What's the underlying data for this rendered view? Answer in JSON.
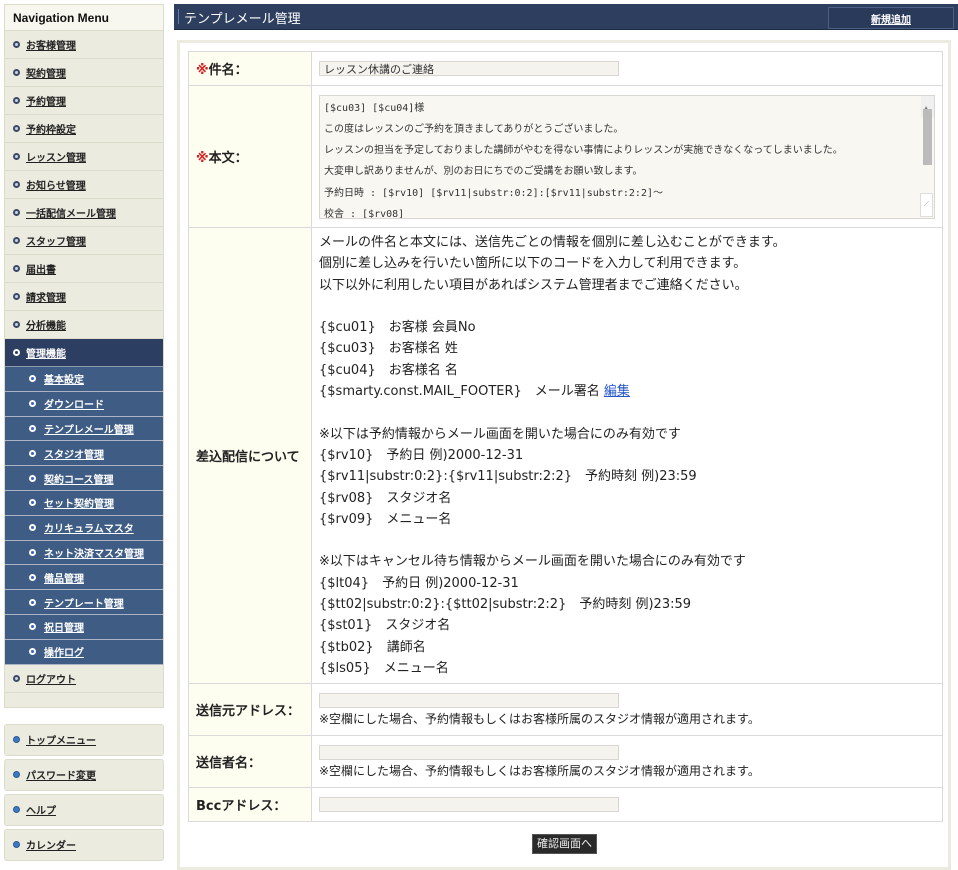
{
  "sidebar": {
    "title": "Navigation Menu",
    "items": [
      {
        "label": "お客様管理"
      },
      {
        "label": "契約管理"
      },
      {
        "label": "予約管理"
      },
      {
        "label": "予約枠設定"
      },
      {
        "label": "レッスン管理"
      },
      {
        "label": "お知らせ管理"
      },
      {
        "label": "一括配信メール管理"
      },
      {
        "label": "スタッフ管理"
      },
      {
        "label": "届出書"
      },
      {
        "label": "請求管理"
      },
      {
        "label": "分析機能"
      }
    ],
    "active_item": {
      "label": "管理機能"
    },
    "sub_items": [
      {
        "label": "基本設定"
      },
      {
        "label": "ダウンロード"
      },
      {
        "label": "テンプレメール管理"
      },
      {
        "label": "スタジオ管理"
      },
      {
        "label": "契約コース管理"
      },
      {
        "label": "セット契約管理"
      },
      {
        "label": "カリキュラムマスタ"
      },
      {
        "label": "ネット決済マスタ管理"
      },
      {
        "label": "備品管理"
      },
      {
        "label": "テンプレート管理"
      },
      {
        "label": "祝日管理"
      },
      {
        "label": "操作ログ"
      }
    ],
    "logout": {
      "label": "ログアウト"
    },
    "secondary": [
      {
        "label": "トップメニュー"
      },
      {
        "label": "パスワード変更"
      },
      {
        "label": "ヘルプ"
      },
      {
        "label": "カレンダー"
      }
    ]
  },
  "header": {
    "title": "テンプレメール管理",
    "new_button": "新規追加"
  },
  "form": {
    "required_mark": "※",
    "subject": {
      "label": "件名：",
      "value": "レッスン休講のご連絡"
    },
    "body": {
      "label": "本文：",
      "lines": [
        "[$cu03] [$cu04]様",
        "この度はレッスンのご予約を頂きましてありがとうございました。",
        "レッスンの担当を予定しておりました講師がやむを得ない事情によりレッスンが実施できなくなってしまいました。",
        "大変申し訳ありませんが、別のお日にちでのご受講をお願い致します。",
        "予約日時 : [$rv10] [$rv11|substr:0:2]:[$rv11|substr:2:2]〜",
        "校舎 : [$rv08]"
      ]
    },
    "merge_info": {
      "label": "差込配信について",
      "intro": [
        "メールの件名と本文には、送信先ごとの情報を個別に差し込むことができます。",
        "個別に差し込みを行いたい箇所に以下のコードを入力して利用できます。",
        "以下以外に利用したい項目があればシステム管理者までご連絡ください。"
      ],
      "customer_codes": [
        "{$cu01}　お客様 会員No",
        "{$cu03}　お客様名 姓",
        "{$cu04}　お客様名 名"
      ],
      "footer_code": "{$smarty.const.MAIL_FOOTER}　メール署名 ",
      "edit_link": "編集",
      "reservation_note": "※以下は予約情報からメール画面を開いた場合にのみ有効です",
      "reservation_codes": [
        "{$rv10}　予約日 例)2000-12-31",
        "{$rv11|substr:0:2}:{$rv11|substr:2:2}　予約時刻 例)23:59",
        "{$rv08}　スタジオ名",
        "{$rv09}　メニュー名"
      ],
      "waitlist_note": "※以下はキャンセル待ち情報からメール画面を開いた場合にのみ有効です",
      "waitlist_codes": [
        "{$lt04}　予約日 例)2000-12-31",
        "{$tt02|substr:0:2}:{$tt02|substr:2:2}　予約時刻 例)23:59",
        "{$st01}　スタジオ名",
        "{$tb02}　講師名",
        "{$ls05}　メニュー名"
      ]
    },
    "from_address": {
      "label": "送信元アドレス：",
      "value": "",
      "note": "※空欄にした場合、予約情報もしくはお客様所属のスタジオ情報が適用されます。"
    },
    "sender_name": {
      "label": "送信者名：",
      "value": "",
      "note": "※空欄にした場合、予約情報もしくはお客様所属のスタジオ情報が適用されます。"
    },
    "bcc_address": {
      "label": "Bccアドレス：",
      "value": ""
    },
    "confirm_button": "確認画面へ"
  }
}
